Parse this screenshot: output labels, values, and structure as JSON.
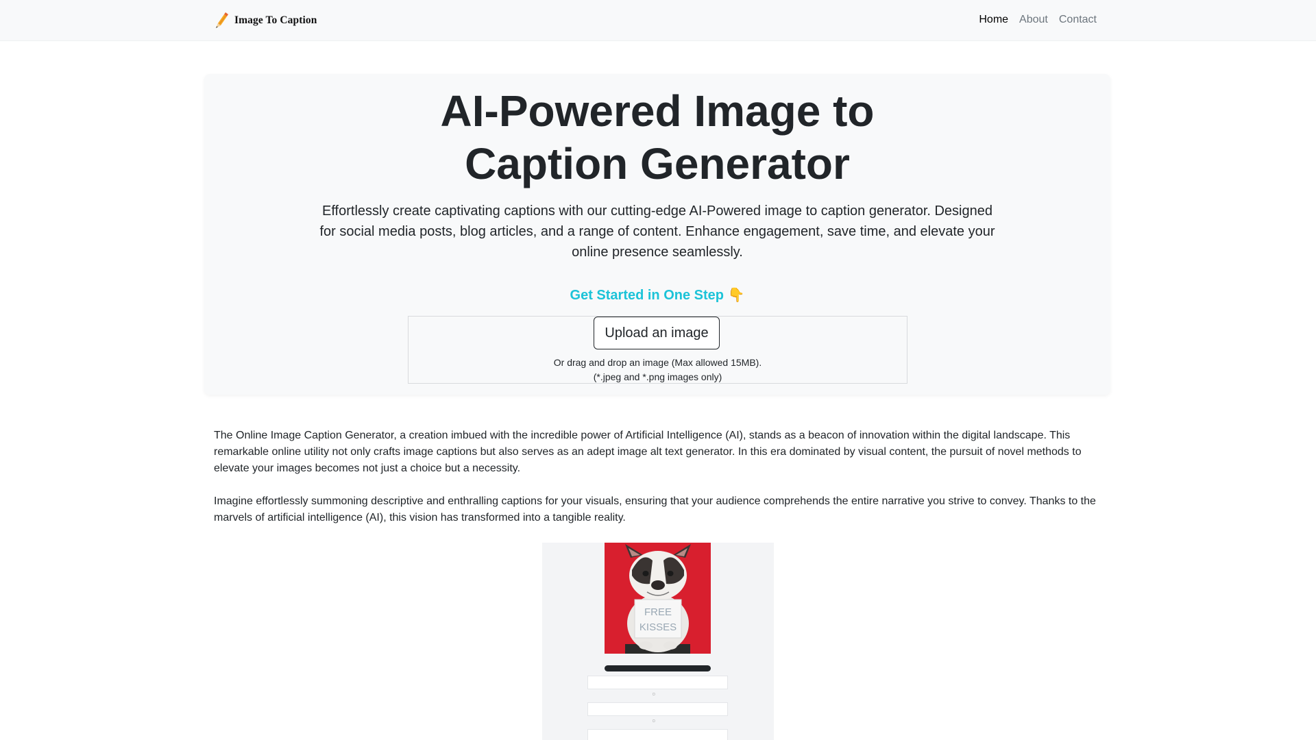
{
  "navbar": {
    "brand": "Image To Caption",
    "links": [
      "Home",
      "About",
      "Contact"
    ],
    "active": "Home"
  },
  "hero": {
    "title_line1": "AI-Powered Image to",
    "title_line2": "Caption Generator",
    "lead": "Effortlessly create captivating captions with our cutting-edge AI-Powered image to caption generator. Designed for social media posts, blog articles, and a range of content. Enhance engagement, save time, and elevate your online presence seamlessly.",
    "cta": "Get Started in One Step 👇",
    "upload_label": "Upload an image",
    "drop_hint_line1": "Or drag and drop an image (Max allowed 15MB).",
    "drop_hint_line2": "(*.jpeg and *.png images only)"
  },
  "content": {
    "paragraph1": "The Online Image Caption Generator, a creation imbued with the incredible power of Artificial Intelligence (AI), stands as a beacon of innovation within the digital landscape. This remarkable online utility not only crafts image captions but also serves as an adept image alt text generator. In this era dominated by visual content, the pursuit of novel methods to elevate your images becomes not just a choice but a necessity.",
    "paragraph2": "Imagine effortlessly summoning descriptive and enthralling captions for your visuals, ensuring that your audience comprehends the entire narrative you strive to convey. Thanks to the marvels of artificial intelligence (AI), this vision has transformed into a tangible reality."
  },
  "preview": {
    "sign_line1": "FREE",
    "sign_line2": "KISSES"
  },
  "colors": {
    "cta": "#1cc3d8",
    "navbar_bg": "#f8f9fa",
    "hero_bg": "#f8f9fa",
    "photo_bg": "#d81f2e"
  }
}
